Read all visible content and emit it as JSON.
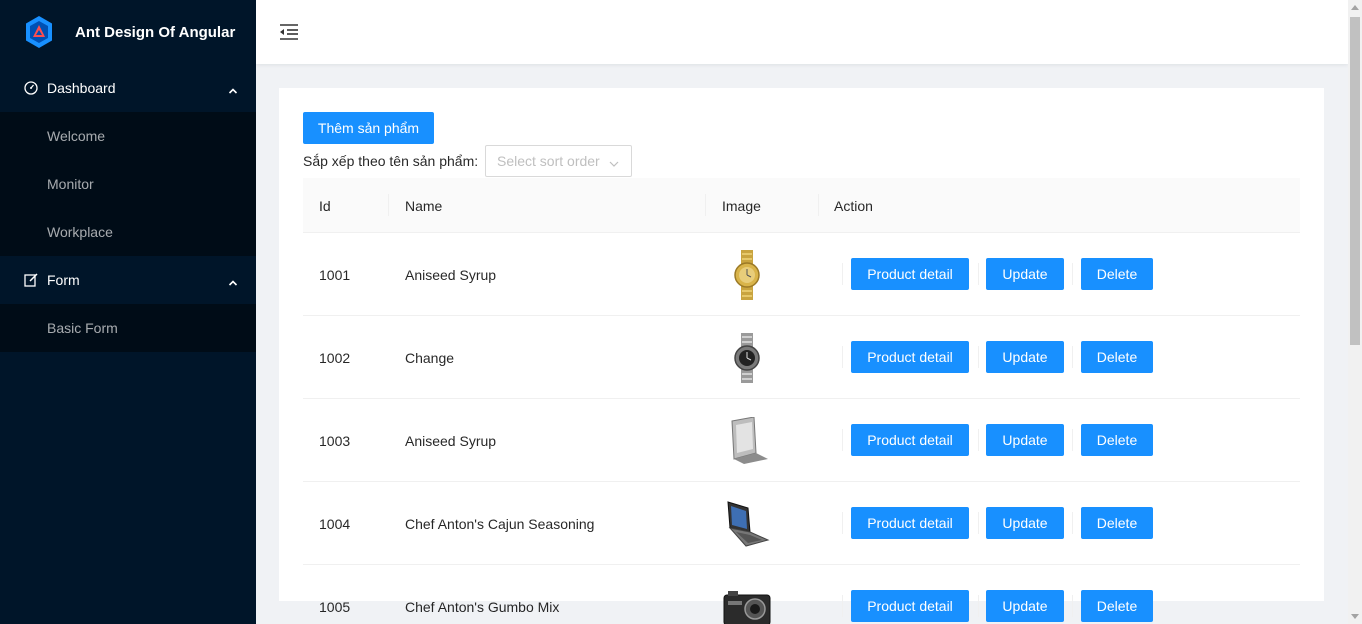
{
  "app": {
    "title": "Ant Design Of Angular"
  },
  "sidebar": {
    "groups": [
      {
        "label": "Dashboard",
        "icon": "dashboard-icon",
        "items": [
          "Welcome",
          "Monitor",
          "Workplace"
        ]
      },
      {
        "label": "Form",
        "icon": "form-icon",
        "items": [
          "Basic Form"
        ]
      }
    ]
  },
  "toolbar": {
    "add_button": "Thêm sản phẩm",
    "sort_label": "Sắp xếp theo tên sản phẩm:",
    "sort_placeholder": "Select sort order"
  },
  "table": {
    "columns": [
      "Id",
      "Name",
      "Image",
      "Action"
    ],
    "rows": [
      {
        "id": "1001",
        "name": "Aniseed Syrup",
        "image": "gold-watch"
      },
      {
        "id": "1002",
        "name": "Change",
        "image": "steel-watch"
      },
      {
        "id": "1003",
        "name": "Aniseed Syrup",
        "image": "silver-laptop"
      },
      {
        "id": "1004",
        "name": "Chef Anton's Cajun Seasoning",
        "image": "open-laptop"
      },
      {
        "id": "1005",
        "name": "Chef Anton's Gumbo Mix",
        "image": "camera"
      }
    ],
    "actions": {
      "detail": "Product detail",
      "update": "Update",
      "delete": "Delete"
    }
  },
  "colors": {
    "sider": "#001529",
    "submenu": "#000c17",
    "primary": "#1890ff",
    "logo": "#1890ff",
    "logo_accent": "#ff4d4f"
  }
}
